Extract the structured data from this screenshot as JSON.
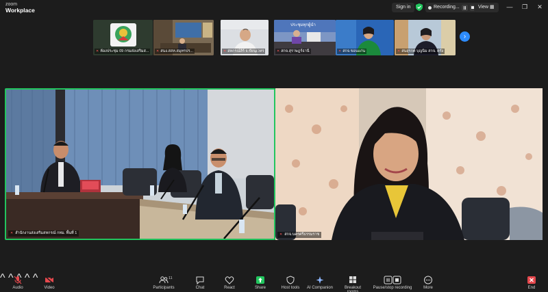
{
  "window": {
    "brand_small": "zoom",
    "brand_large": "Workplace",
    "signin_label": "Sign in",
    "recording_label": "Recording...",
    "view_label": "View"
  },
  "thumbnails": [
    {
      "label": "ห้องประชุม 09 กรมส่งเสริมส..."
    },
    {
      "label": "สนง.สสห.สมุทรปร..."
    },
    {
      "label": "สหกรณ์ลีร์ จ.ขัยนุเวหร"
    },
    {
      "label": "สกจ.สุราษฎร์ธานี"
    },
    {
      "label": "สกจ.ขอนแก่น"
    },
    {
      "label": "สนสุรกต บุญนิม สกจ. ตรัง"
    }
  ],
  "thumb_banner_text": "ประชุมทุกผู้นำ",
  "main_tiles": [
    {
      "name": "สำนักงานส่งเสริมสหกรณ์ กทม. พื้นที่ 1"
    },
    {
      "name": "สกจ.นครศรีธรรมราช"
    }
  ],
  "toolbar": [
    {
      "label": "Audio",
      "icon": "microphone-muted-icon"
    },
    {
      "label": "Video",
      "icon": "video-off-icon"
    },
    {
      "label": "Participants",
      "icon": "participants-icon",
      "count": "11"
    },
    {
      "label": "Chat",
      "icon": "chat-icon"
    },
    {
      "label": "React",
      "icon": "heart-icon"
    },
    {
      "label": "Share",
      "icon": "share-screen-icon"
    },
    {
      "label": "Host tools",
      "icon": "shield-icon"
    },
    {
      "label": "AI Companion",
      "icon": "sparkle-icon"
    },
    {
      "label": "Breakout rooms",
      "icon": "grid-icon"
    },
    {
      "label": "Pause/stop recording",
      "icon": "record-controls-icon"
    },
    {
      "label": "More",
      "icon": "more-icon"
    },
    {
      "label": "End",
      "icon": "end-call-icon"
    }
  ],
  "colors": {
    "accent": "#2d8cff",
    "active_speaker_border": "#22c55e",
    "muted_red": "#e5484d",
    "share_green": "#22c55e",
    "background": "#1c1c1c"
  }
}
